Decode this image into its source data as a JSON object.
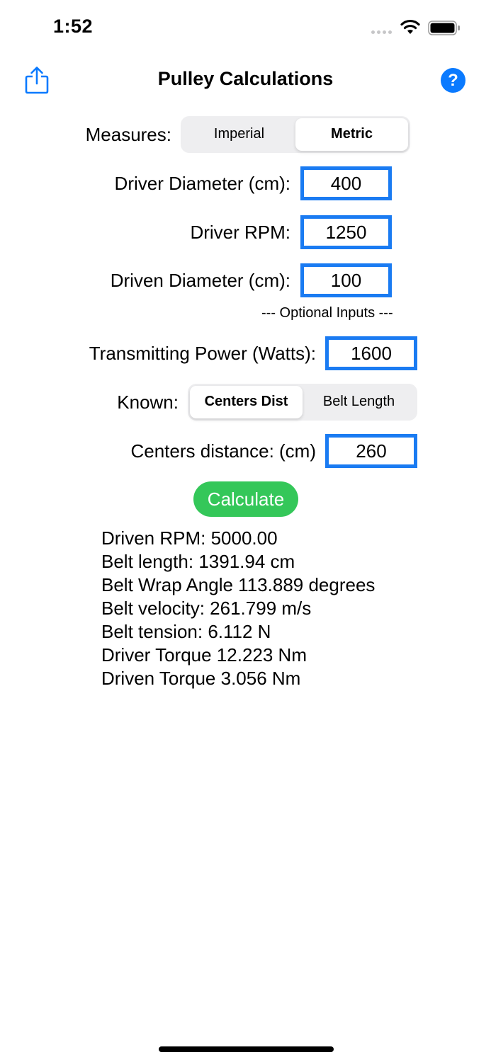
{
  "status_bar": {
    "time": "1:52"
  },
  "nav": {
    "title": "Pulley Calculations",
    "help_label": "?"
  },
  "measures": {
    "label": "Measures:",
    "options": [
      "Imperial",
      "Metric"
    ],
    "selected": "Metric"
  },
  "inputs": {
    "driver_diameter": {
      "label": "Driver Diameter (cm):",
      "value": "400"
    },
    "driver_rpm": {
      "label": "Driver RPM:",
      "value": "1250"
    },
    "driven_diameter": {
      "label": "Driven Diameter (cm):",
      "value": "100"
    }
  },
  "optional_header": "--- Optional Inputs ---",
  "optional": {
    "power": {
      "label": "Transmitting Power (Watts):",
      "value": "1600"
    },
    "known": {
      "label": "Known:",
      "options": [
        "Centers Dist",
        "Belt Length"
      ],
      "selected": "Centers Dist"
    },
    "centers": {
      "label": "Centers distance: (cm)",
      "value": "260"
    }
  },
  "calculate_label": "Calculate",
  "results": [
    "Driven RPM: 5000.00",
    "Belt length: 1391.94 cm",
    "Belt Wrap Angle 113.889 degrees",
    "Belt velocity: 261.799 m/s",
    "Belt tension: 6.112 N",
    "Driver Torque 12.223 Nm",
    "Driven Torque 3.056 Nm"
  ],
  "colors": {
    "accent": "#0a7aff",
    "input_border": "#1a7bf2",
    "calculate": "#34c759"
  }
}
